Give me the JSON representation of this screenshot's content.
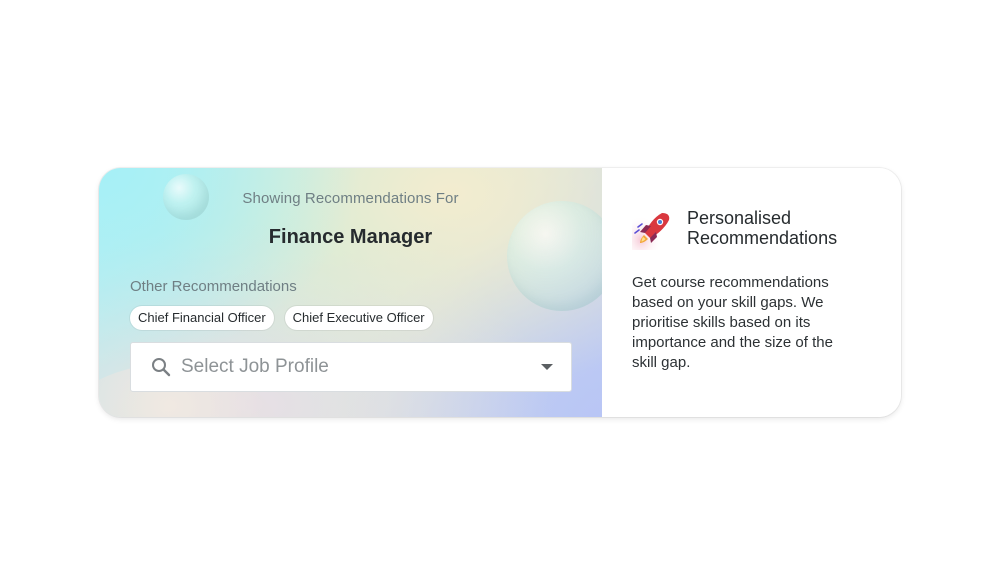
{
  "recommendation_panel": {
    "showing_label": "Showing Recommendations For",
    "job_title": "Finance Manager",
    "other_label": "Other Recommendations",
    "chips": [
      "Chief Financial Officer",
      "Chief Executive Officer"
    ],
    "select": {
      "placeholder": "Select Job Profile",
      "icon": "search-icon"
    }
  },
  "info_panel": {
    "icon": "rocket-icon",
    "title_line1": "Personalised",
    "title_line2": "Recommendations",
    "description": "Get course recommendations based on your skill gaps. We prioritise skills based on its importance and the size of the skill gap."
  },
  "colors": {
    "text_dark": "#262b2e",
    "text_muted": "#6f7f84",
    "placeholder": "#8e9396",
    "gradient_cyan": "#a6f0f6",
    "gradient_blue": "#b9c6f5"
  }
}
